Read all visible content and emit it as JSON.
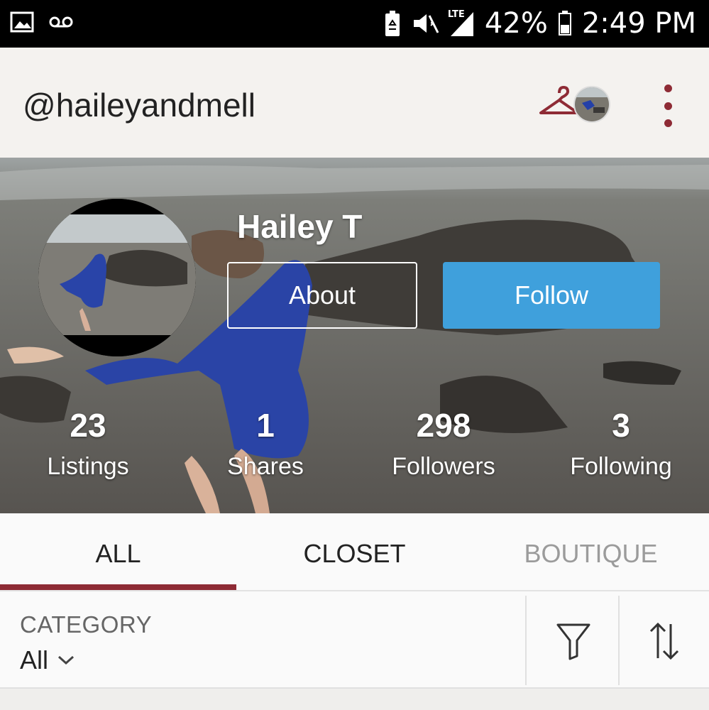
{
  "status_bar": {
    "battery": "42%",
    "time": "2:49 PM",
    "network": "LTE"
  },
  "app_bar": {
    "username": "@haileyandmell"
  },
  "profile": {
    "name": "Hailey T",
    "about_label": "About",
    "follow_label": "Follow"
  },
  "stats": [
    {
      "value": "23",
      "label": "Listings"
    },
    {
      "value": "1",
      "label": "Shares"
    },
    {
      "value": "298",
      "label": "Followers"
    },
    {
      "value": "3",
      "label": "Following"
    }
  ],
  "tabs": [
    {
      "label": "ALL",
      "active": true
    },
    {
      "label": "CLOSET",
      "active": false
    },
    {
      "label": "BOUTIQUE",
      "active": false
    }
  ],
  "filter": {
    "category_label": "CATEGORY",
    "category_value": "All"
  },
  "colors": {
    "accent": "#8e2b35",
    "follow_blue": "#3fa0dc"
  }
}
